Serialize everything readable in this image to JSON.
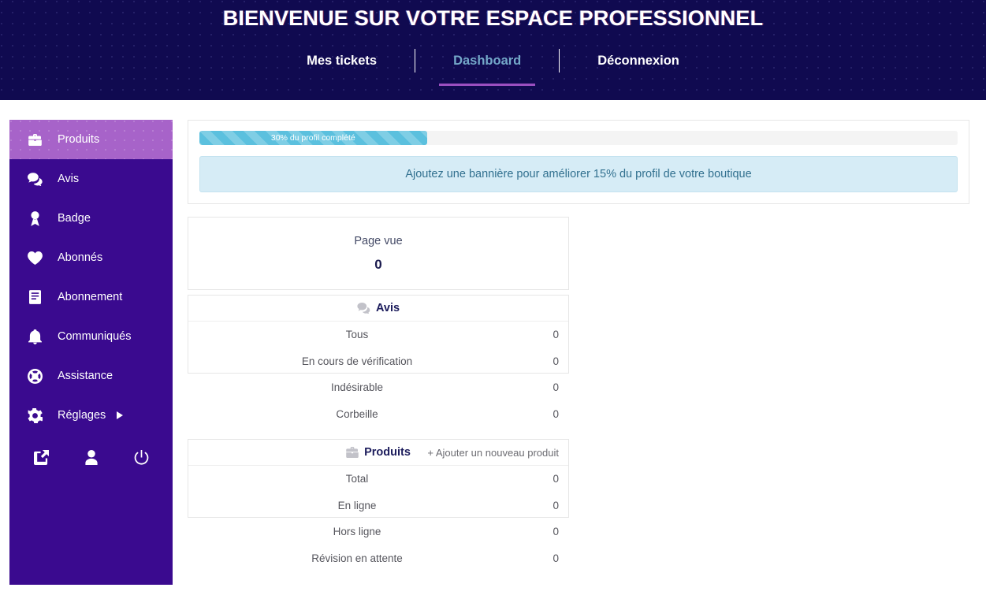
{
  "header": {
    "title": "BIENVENUE SUR VOTRE ESPACE PROFESSIONNEL",
    "nav": [
      {
        "label": "Mes tickets",
        "active": false
      },
      {
        "label": "Dashboard",
        "active": true
      },
      {
        "label": "Déconnexion",
        "active": false
      }
    ],
    "accent_underline": "#9b4fc0",
    "active_color": "#74a8c9",
    "background": "#100a50"
  },
  "sidebar": {
    "background": "#3a0a8f",
    "active_background": "#a763c9",
    "items": [
      {
        "label": "Produits",
        "icon": "briefcase-icon",
        "active": true
      },
      {
        "label": "Avis",
        "icon": "comments-icon",
        "active": false
      },
      {
        "label": "Badge",
        "icon": "award-icon",
        "active": false
      },
      {
        "label": "Abonnés",
        "icon": "heart-icon",
        "active": false
      },
      {
        "label": "Abonnement",
        "icon": "book-icon",
        "active": false
      },
      {
        "label": "Communiqués",
        "icon": "bell-icon",
        "active": false
      },
      {
        "label": "Assistance",
        "icon": "lifebuoy-icon",
        "active": false
      },
      {
        "label": "Réglages",
        "icon": "gear-icon",
        "active": false,
        "has_caret": true
      }
    ],
    "bottom_icons": [
      {
        "name": "external-link-icon"
      },
      {
        "name": "user-icon"
      },
      {
        "name": "power-icon"
      }
    ]
  },
  "main": {
    "profile": {
      "progress_percent": 30,
      "progress_label": "30% du profil complété",
      "progress_fill_color": "#5bc0de",
      "banner_notice": "Ajoutez une bannière pour améliorer 15% du profil de votre boutique",
      "banner_color": "#d6ecf6"
    },
    "page_view": {
      "title": "Page vue",
      "value": "0"
    },
    "avis_card": {
      "title": "Avis",
      "icon": "comments-icon",
      "rows": [
        {
          "label": "Tous",
          "value": "0"
        },
        {
          "label": "En cours de vérification",
          "value": "0"
        },
        {
          "label": "Indésirable",
          "value": "0"
        },
        {
          "label": "Corbeille",
          "value": "0"
        }
      ]
    },
    "produits_card": {
      "title": "Produits",
      "icon": "briefcase-icon",
      "action_label": "+ Ajouter un nouveau produit",
      "rows": [
        {
          "label": "Total",
          "value": "0"
        },
        {
          "label": "En ligne",
          "value": "0"
        },
        {
          "label": "Hors ligne",
          "value": "0"
        },
        {
          "label": "Révision en attente",
          "value": "0"
        }
      ]
    }
  }
}
